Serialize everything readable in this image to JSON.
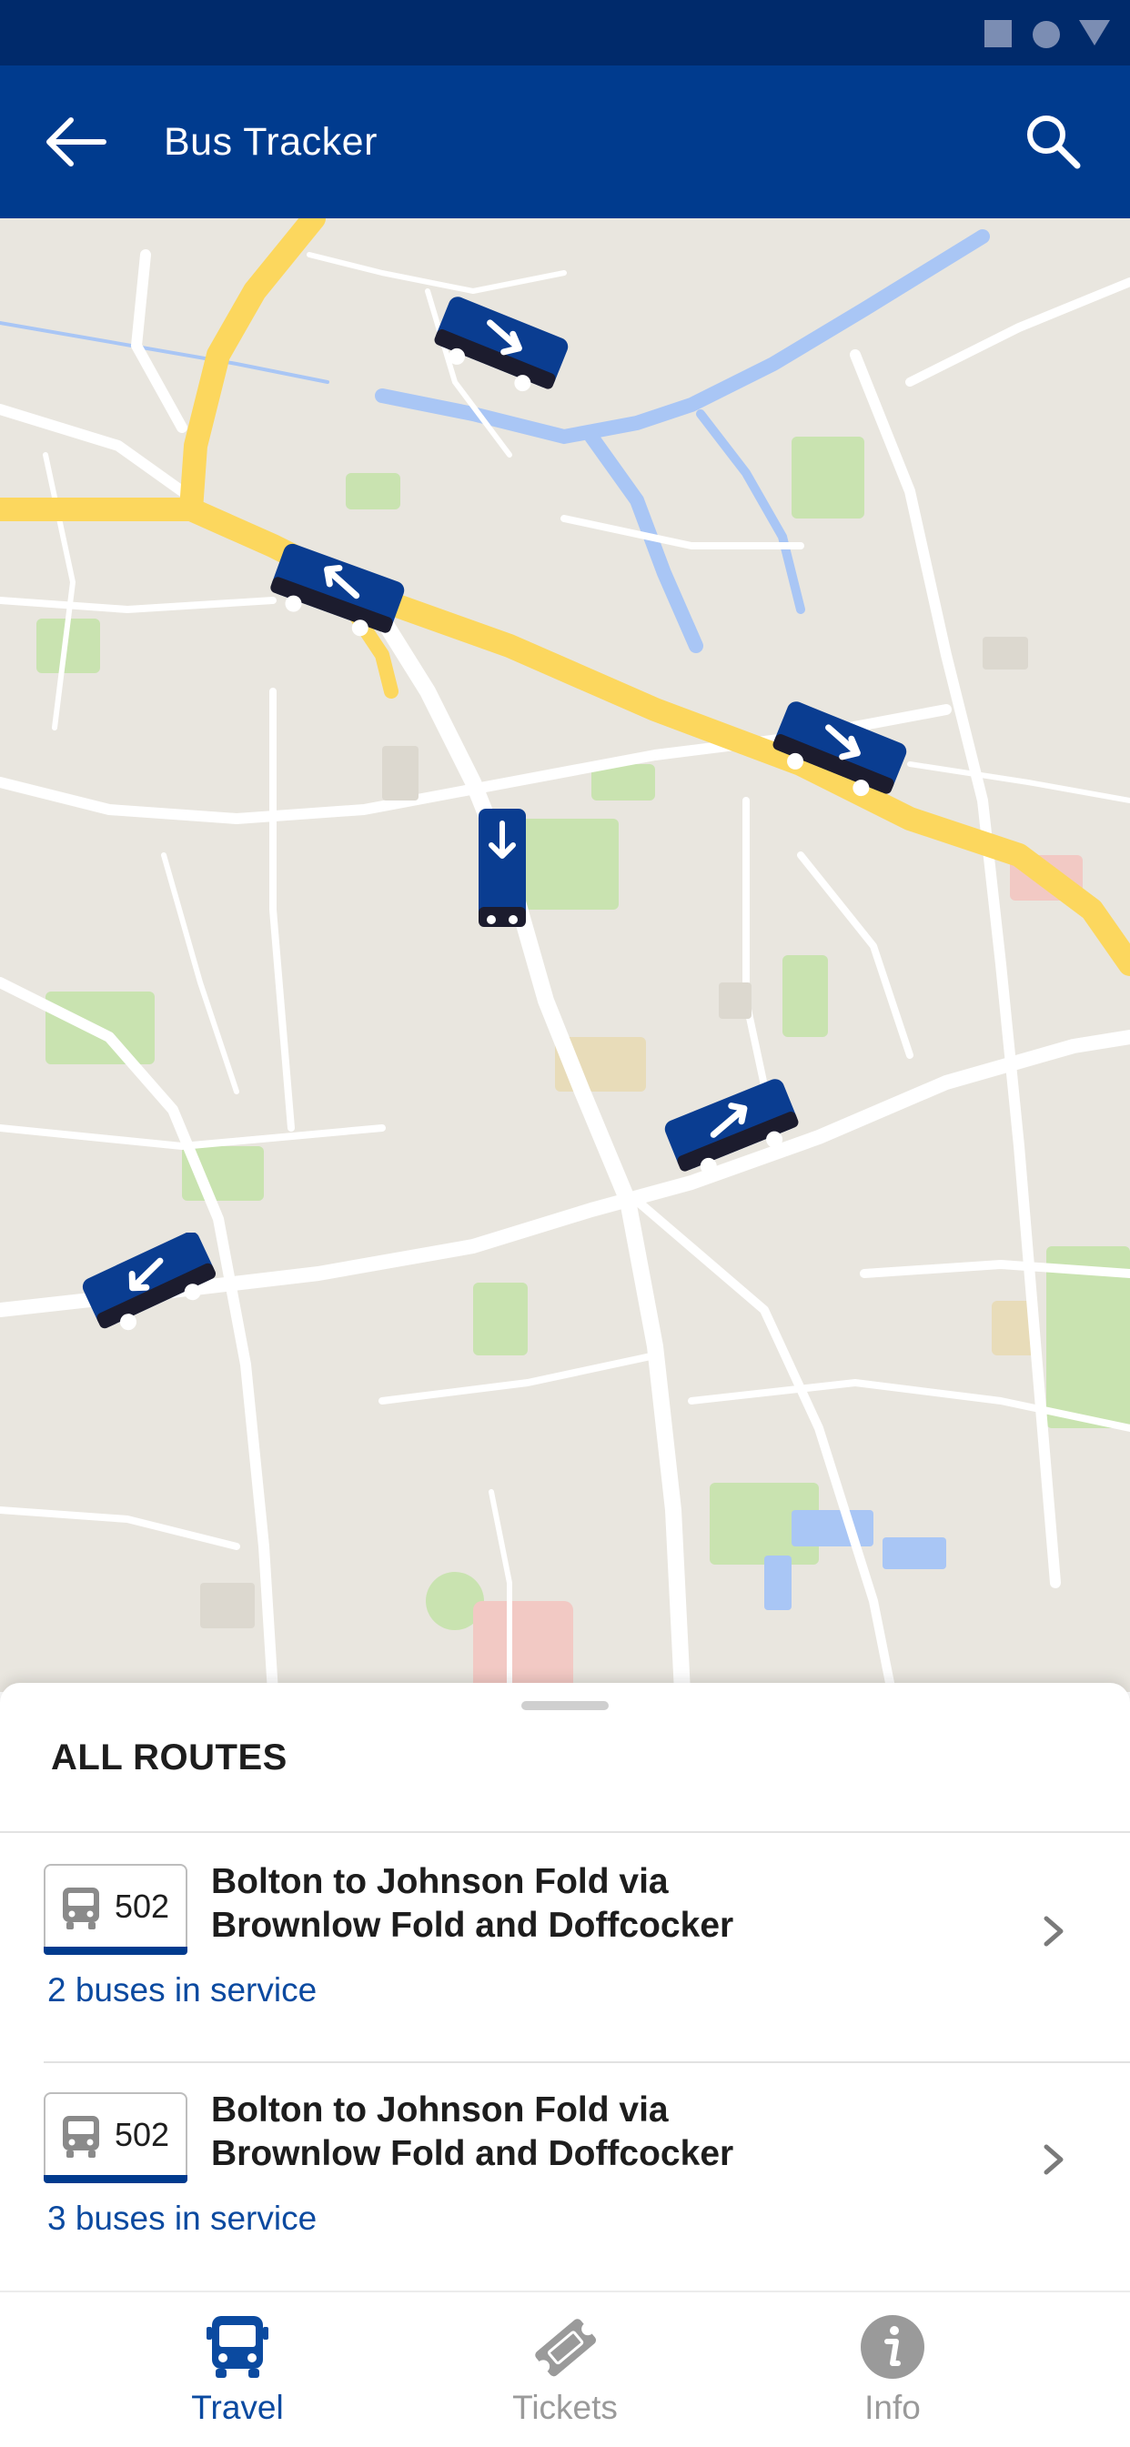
{
  "app_bar": {
    "title": "Bus Tracker",
    "back_icon": "arrow-left-icon",
    "search_icon": "search-icon"
  },
  "status_bar": {
    "icons": [
      "square-icon",
      "circle-icon",
      "triangle-icon"
    ]
  },
  "map": {
    "bus_markers": [
      {
        "direction": "down-right"
      },
      {
        "direction": "up-left"
      },
      {
        "direction": "down-right"
      },
      {
        "direction": "down"
      },
      {
        "direction": "up-right"
      },
      {
        "direction": "down-left"
      }
    ]
  },
  "sheet": {
    "heading": "ALL ROUTES",
    "routes": [
      {
        "number": "502",
        "title_line1": "Bolton to Johnson Fold via",
        "title_line2": "Brownlow Fold and Doffcocker",
        "service": "2 buses in service"
      },
      {
        "number": "502",
        "title_line1": "Bolton to Johnson Fold via",
        "title_line2": "Brownlow Fold and Doffcocker",
        "service": "3 buses in service"
      }
    ]
  },
  "bottom_nav": {
    "items": [
      {
        "label": "Travel",
        "icon": "bus-icon",
        "active": true
      },
      {
        "label": "Tickets",
        "icon": "ticket-icon",
        "active": false
      },
      {
        "label": "Info",
        "icon": "info-icon",
        "active": false
      }
    ]
  },
  "colors": {
    "primary": "#003b8e",
    "status_bar": "#002a6b",
    "active_nav": "#0b4aa0",
    "inactive_nav": "#9a9a9a",
    "major_road": "#fcd75e",
    "water": "#a9c6f5",
    "park": "#c9e3b0"
  }
}
